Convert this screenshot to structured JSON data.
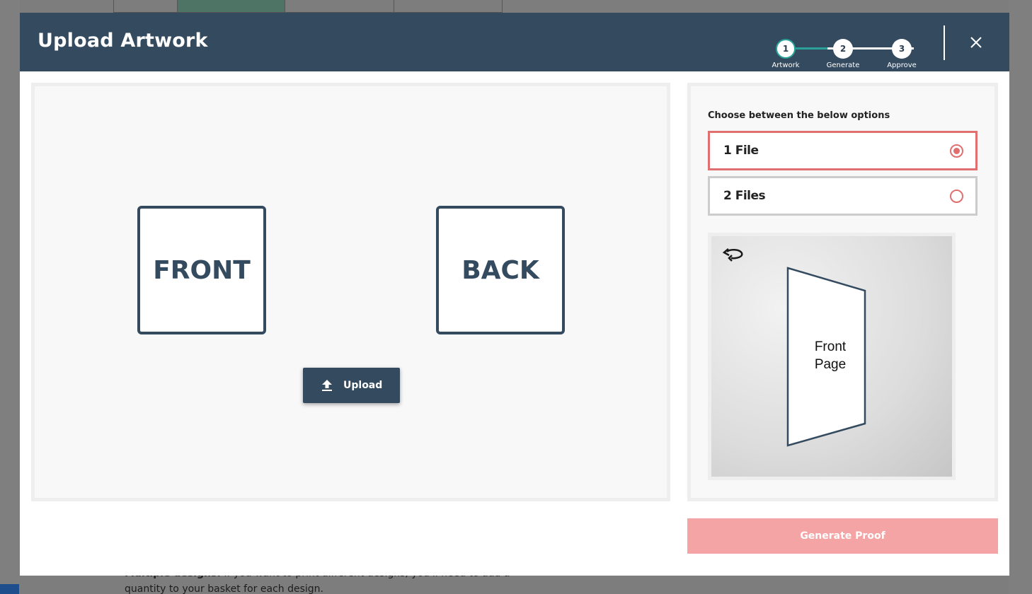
{
  "background": {
    "text_bold": "Multiple designs:",
    "text": " If you want to print different designs, you'll need to add a quantity to your basket for each design."
  },
  "modal": {
    "title": "Upload Artwork",
    "steps": [
      {
        "number": "1",
        "label": "Artwork",
        "active": true
      },
      {
        "number": "2",
        "label": "Generate",
        "active": false
      },
      {
        "number": "3",
        "label": "Approve",
        "active": false
      }
    ],
    "close_icon": "close-icon"
  },
  "artwork": {
    "front_label": "FRONT",
    "back_label": "BACK",
    "upload_label": "Upload",
    "upload_icon": "upload-icon"
  },
  "options": {
    "heading": "Choose between the below options",
    "items": [
      {
        "label": "1 File",
        "selected": true
      },
      {
        "label": "2 Files",
        "selected": false
      }
    ]
  },
  "preview": {
    "page_line1": "Front",
    "page_line2": "Page",
    "rotate_icon": "rotate-icon"
  },
  "actions": {
    "generate_label": "Generate Proof"
  },
  "colors": {
    "header": "#344a5f",
    "accent_teal": "#2aa198",
    "selected_border": "#e06f6f",
    "generate_button": "#f4a4a4"
  }
}
